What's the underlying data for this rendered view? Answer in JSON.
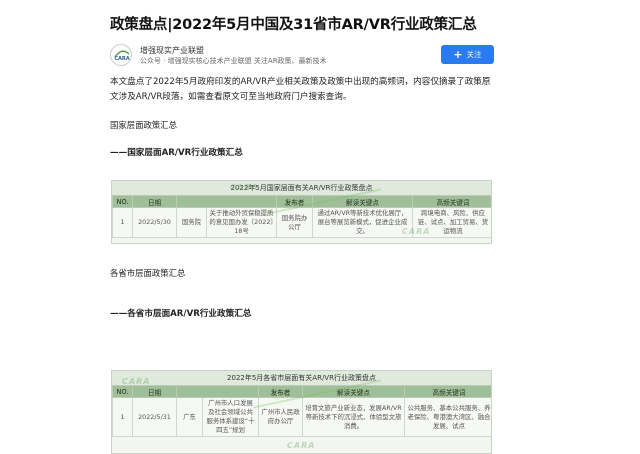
{
  "article": {
    "title": "政策盘点|2022年5月中国及31省市AR/VR行业政策汇总",
    "intro": "本文盘点了2022年5月政府印发的AR/VR产业相关政策及政策中出现的高频词，内容仅摘录了政策原文涉及AR/VR段落，如需查看原文可至当地政府门户搜索查询。",
    "section_national": "国家层面政策汇总",
    "sub_national": "——国家层面AR/VR行业政策汇总",
    "section_provincial": "各省市层面政策汇总",
    "sub_provincial": "——各省市层面AR/VR行业政策汇总"
  },
  "account": {
    "name": "增强现实产业联盟",
    "desc": "公众号 · 增强现实核心技术产业联盟 关注AR政策、最新技术",
    "avatar_text": "CARA",
    "follow_label": "关注",
    "accent": "#2a7bf0"
  },
  "table_national": {
    "caption": "2022年5月国家层面有关AR/VR行业政策盘点",
    "headers": [
      "NO.",
      "日期",
      "",
      "",
      "发布者",
      "解读关键点",
      "高频关键词"
    ],
    "row": [
      "1",
      "2022/5/30",
      "国务院",
      "关于推动外贸保稳提质的意见国办发〔2022〕18号",
      "国务院办公厅",
      "通过AR/VR等新技术优化展厅，展台等展览新模式，促进企业成交。",
      "跨境电商、风险、供应链、试点、加工贸易、货运物流"
    ]
  },
  "table_provincial": {
    "caption": "2022年5月各省市层面有关AR/VR行业政策盘点",
    "headers": [
      "NO.",
      "日期",
      "",
      "",
      "发布者",
      "解读关键点",
      "高频关键词"
    ],
    "row": [
      "1",
      "2022/5/31",
      "广东",
      "广州市人口发展及社会领域公共服务体系建设“十四五”规划",
      "广州市人民政府办公厅",
      "培育文旅产业新业态，发展AR/VR等新技术下的沉浸式、体验型文旅消费。",
      "公共服务、基本公共服务、养老保险、粤港澳大湾区、融合发展、试点"
    ]
  },
  "watermark": "CARA"
}
